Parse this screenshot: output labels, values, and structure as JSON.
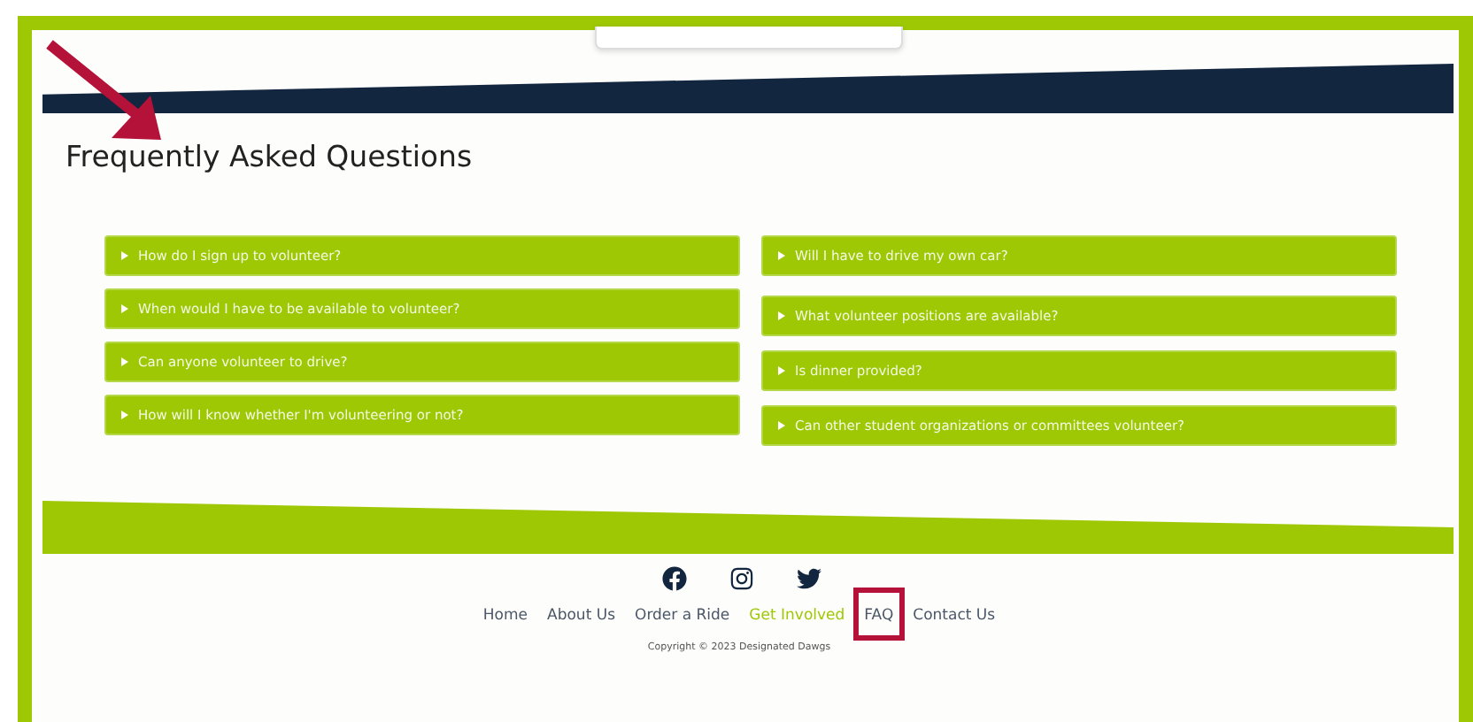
{
  "page": {
    "title": "Frequently Asked Questions"
  },
  "faq": {
    "columns": [
      [
        {
          "question": "How do I sign up to volunteer?",
          "expanded": false
        },
        {
          "question": "When would I have to be available to volunteer?",
          "expanded": false
        },
        {
          "question": "Can anyone volunteer to drive?",
          "expanded": false
        },
        {
          "question": "How will I know whether I'm volunteering or not?",
          "expanded": false
        }
      ],
      [
        {
          "question": "Will I have to drive my own car?",
          "expanded": false
        },
        {
          "question": "What volunteer positions are available?",
          "expanded": false
        },
        {
          "question": "Is dinner provided?",
          "expanded": false
        },
        {
          "question": "Can other student organizations or committees volunteer?",
          "expanded": false
        }
      ]
    ]
  },
  "footer": {
    "nav": [
      {
        "label": "Home",
        "selected": false
      },
      {
        "label": "About Us",
        "selected": false
      },
      {
        "label": "Order a Ride",
        "selected": false
      },
      {
        "label": "Get Involved",
        "selected": true
      },
      {
        "label": "FAQ",
        "selected": false
      },
      {
        "label": "Contact Us",
        "selected": false
      }
    ],
    "copyright": "Copyright © 2023 Designated Dawgs"
  }
}
